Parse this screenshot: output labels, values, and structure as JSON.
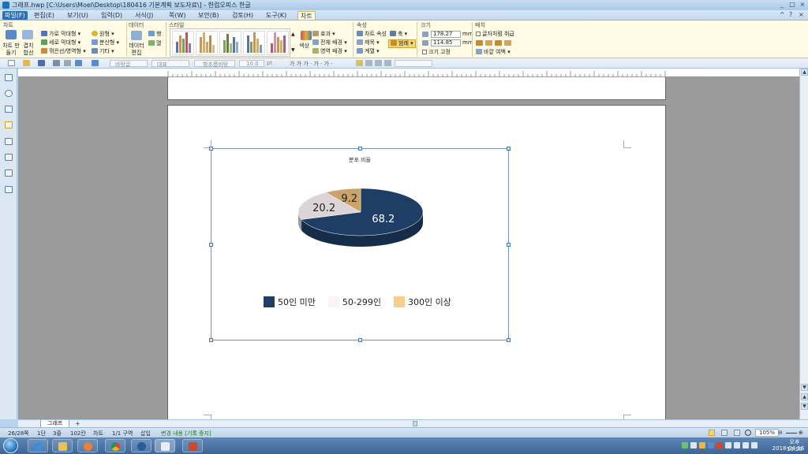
{
  "window": {
    "title": "그래프.hwp [C:\\Users\\Moel\\Desktop\\180416 기본계획 보도자료\\] - 한컴오피스 한글",
    "controls": [
      "_",
      "□",
      "×"
    ]
  },
  "menubar": {
    "items": [
      "파일(F)",
      "편집(E)",
      "보기(U)",
      "입력(D)",
      "서식(J)",
      "쪽(W)",
      "보안(B)",
      "검토(H)",
      "도구(K)",
      "차트"
    ],
    "active": "차트",
    "right_icons": [
      "^",
      "?",
      "×"
    ]
  },
  "ribbon": {
    "groups": {
      "chart": "차트",
      "data": "데이터",
      "style": "스타일",
      "props": "속성",
      "size": "크기",
      "arrange": "배치"
    },
    "chart_make": "차트 만들기",
    "combine": "겹치 합선",
    "bar_horizontal": "가로 막대형",
    "bar_vertical": "세로 막대형",
    "line_area": "꺾은선/영역형",
    "pie": "원형",
    "scatter": "분산형",
    "other": "기타",
    "data_edit": "데이터 편집",
    "row": "행",
    "col": "열",
    "color": "색상",
    "effect": "효과",
    "whole_bg": "전체 배경",
    "area_bg": "영역 배경",
    "chart_props": "차트 속성",
    "axis": "축",
    "title": "제목",
    "legend": "범례",
    "series": "계열",
    "width_value": "178.27",
    "height_value": "114.85",
    "unit": "mm",
    "fix_size": "크기 고정",
    "treat_as_char": "글자처럼 취급",
    "outer_margin": "바깥 여백"
  },
  "toolbar2": {
    "style_box": "바탕글",
    "font_box": "함초롬바탕",
    "size_box": "10.0",
    "size_unit": "pt",
    "font_lang": "대표"
  },
  "chart_data": {
    "type": "pie",
    "title": "분포 비율",
    "categories": [
      "50인 미만",
      "50-299인",
      "300인 이상"
    ],
    "values": [
      68.2,
      20.2,
      9.2
    ],
    "colors": [
      "#1f3e66",
      "#ddd4d8",
      "#c8a46b"
    ],
    "legend_colors": [
      "#1f3e66",
      "#fbf4f6",
      "#f4cf8c"
    ],
    "legend_position": "bottom",
    "style": "3d"
  },
  "statusbar": {
    "page": "26/28쪽",
    "section": "1단",
    "line": "3줄",
    "column": "102칸",
    "mode": "차트",
    "area": "1/1 구역",
    "insert": "삽입",
    "track": "변경 내용 [기록 중지]",
    "zoom": "105%"
  },
  "sheet_tab": "그래프",
  "taskbar": {
    "time": "오후 10:29",
    "date": "2018-04-16"
  }
}
